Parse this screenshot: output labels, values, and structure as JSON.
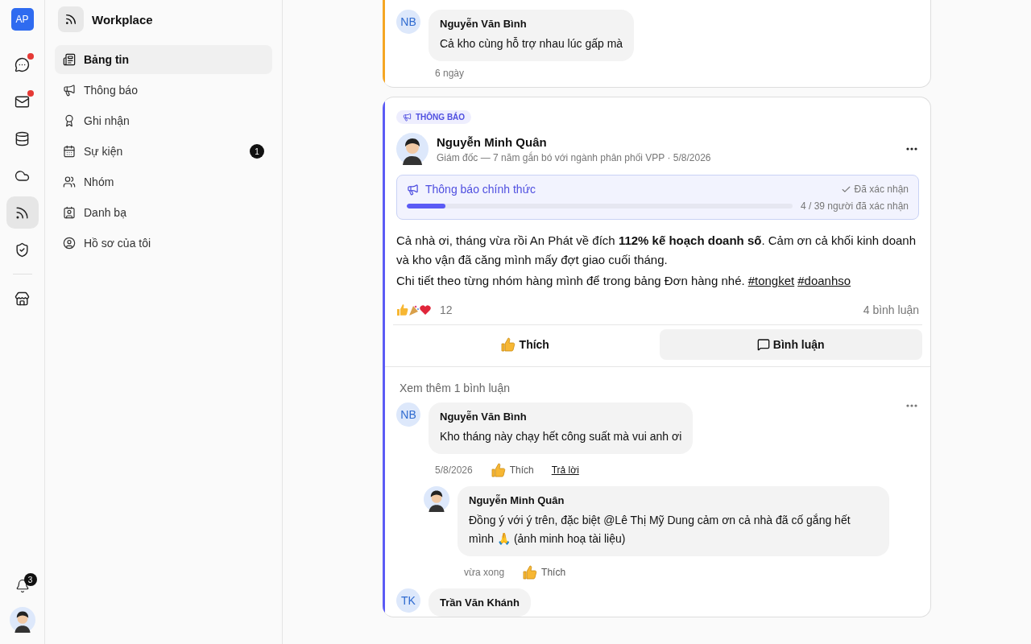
{
  "rail": {
    "logo": "AP",
    "items": [
      {
        "dot": true,
        "selected": false
      },
      {
        "dot": true,
        "selected": false
      },
      {
        "dot": false,
        "selected": false
      },
      {
        "dot": false,
        "selected": false
      },
      {
        "dot": false,
        "selected": true
      },
      {
        "dot": false,
        "selected": false
      },
      {
        "dot": false,
        "selected": false
      }
    ],
    "notifications": {
      "badge": "3"
    }
  },
  "sidebar": {
    "title": "Workplace",
    "items": [
      {
        "label": "Bảng tin",
        "selected": true
      },
      {
        "label": "Thông báo",
        "selected": false
      },
      {
        "label": "Ghi nhận",
        "selected": false
      },
      {
        "label": "Sự kiện",
        "selected": false,
        "badge": "1"
      },
      {
        "label": "Nhóm",
        "selected": false
      },
      {
        "label": "Danh bạ",
        "selected": false
      },
      {
        "label": "Hồ sơ của tôi",
        "selected": false
      }
    ]
  },
  "top_card": {
    "color": "#f5a623",
    "comment": {
      "initials": "NB",
      "name": "Nguyễn Văn Bình",
      "text": "Cả kho cùng hỗ trợ nhau lúc gấp mà",
      "time": "6 ngày"
    }
  },
  "post": {
    "color": "#5b5bf5",
    "tag": "THÔNG BÁO",
    "author": "Nguyễn Minh Quân",
    "subtitle": "Giám đốc — 7 năm gắn bó với ngành phân phối VPP · 5/8/2026",
    "notice": {
      "title": "Thông báo chính thức",
      "status": "Đã xác nhận",
      "level": 0.1,
      "count": "4 / 39 người đã xác nhận"
    },
    "body": [
      "Cả nhà ơi, tháng vừa rồi An Phát về đích **112% kế hoạch doanh số**. Cảm ơn cả khối kinh doanh và kho vận đã căng mình mấy đợt giao cuối tháng.",
      "Chi tiết theo từng nhóm hàng mình để trong bảng Đơn hàng nhé."
    ],
    "hashtags": [
      "#tongket",
      "#doanhso"
    ],
    "reaction_count": "12",
    "comment_count": "4 bình luận",
    "actions": [
      {
        "kind": "like",
        "label": "Thích",
        "selected": false
      },
      {
        "kind": "comment",
        "label": "Bình luận",
        "selected": true
      }
    ],
    "more_comments": "Xem thêm 1 bình luận",
    "comments": [
      {
        "initials": "NB",
        "name": "Nguyễn Văn Bình",
        "text": "Kho tháng này chạy hết công suất mà vui anh ơi",
        "time": "5/8/2026",
        "like": "Thích",
        "reply": "Trả lời",
        "replies": [
          {
            "name": "Nguyễn Minh Quân",
            "text": "Đồng ý với ý trên, đặc biệt @Lê Thị Mỹ Dung cảm ơn cả nhà đã cố gắng hết mình 🙏 (ảnh minh hoạ tài liệu)",
            "time": "vừa xong",
            "like": "Thích"
          }
        ]
      },
      {
        "initials": "TK",
        "name": "Trần Văn Khánh"
      }
    ]
  }
}
